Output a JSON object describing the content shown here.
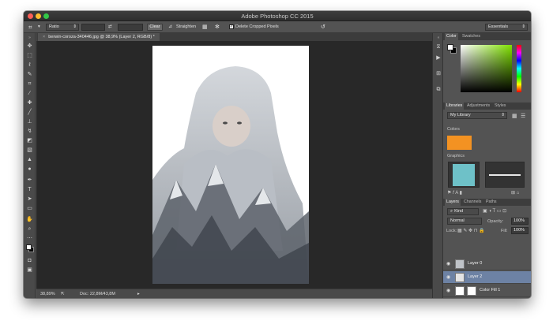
{
  "app": {
    "title": "Adobe Photoshop CC 2015"
  },
  "options_bar": {
    "ratio": "Ratio",
    "clear_label": "Clear",
    "straighten_label": "Straighten",
    "delete_cropped_label": "Delete Cropped Pixels",
    "workspace": "Essentials"
  },
  "document": {
    "tab_label": "berwin-coroza-340446.jpg @ 38,9% (Layer 2, RGB/8) *"
  },
  "status": {
    "zoom": "38,89%",
    "doc_size": "Doc: 22,8M/43,8M"
  },
  "color_panel": {
    "tabs": [
      "Color",
      "Swatches"
    ],
    "foreground": "#ffffff",
    "background": "#000000",
    "picker_hue": "#7fe000"
  },
  "libraries_panel": {
    "tabs": [
      "Libraries",
      "Adjustments",
      "Styles"
    ],
    "library": "My Library",
    "colors_label": "Colors",
    "color_swatch": "#f39222",
    "graphics_label": "Graphics",
    "graphic_color": "#6ec1c8"
  },
  "layers_panel": {
    "tabs": [
      "Layers",
      "Channels",
      "Paths"
    ],
    "kind": "Kind",
    "blend_mode": "Normal",
    "opacity_label": "Opacity:",
    "opacity": "100%",
    "lock_label": "Lock:",
    "fill_label": "Fill:",
    "fill": "100%",
    "layers": [
      {
        "name": "Layer 0",
        "selected": false
      },
      {
        "name": "Layer 2",
        "selected": true
      },
      {
        "name": "Color Fill 1",
        "selected": false
      }
    ]
  },
  "icons": {
    "tools": [
      "move-icon",
      "marquee-icon",
      "lasso-icon",
      "quick-select-icon",
      "crop-icon",
      "eyedropper-icon",
      "healing-icon",
      "brush-icon",
      "stamp-icon",
      "history-brush-icon",
      "eraser-icon",
      "gradient-icon",
      "blur-icon",
      "dodge-icon",
      "pen-icon",
      "type-icon",
      "path-select-icon",
      "shape-icon",
      "hand-icon",
      "zoom-icon"
    ]
  }
}
